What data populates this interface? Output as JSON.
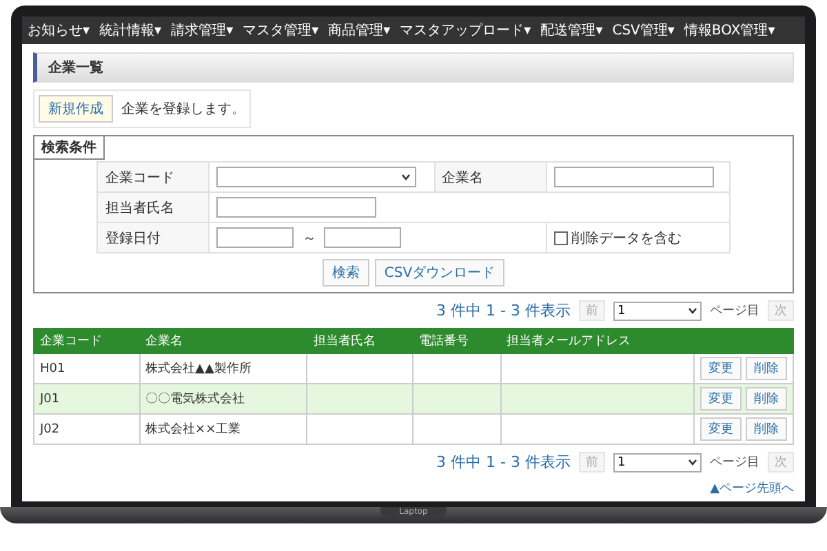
{
  "menu": [
    {
      "label": "お知らせ"
    },
    {
      "label": "統計情報"
    },
    {
      "label": "請求管理"
    },
    {
      "label": "マスタ管理"
    },
    {
      "label": "商品管理"
    },
    {
      "label": "マスタアップロード"
    },
    {
      "label": "配送管理"
    },
    {
      "label": "CSV管理"
    },
    {
      "label": "情報BOX管理"
    }
  ],
  "caret": "▾",
  "page_title": "企業一覧",
  "new_button": "新規作成",
  "new_note": "企業を登録します。",
  "search": {
    "title": "検索条件",
    "company_code_label": "企業コード",
    "company_name_label": "企業名",
    "person_label": "担当者氏名",
    "date_label": "登録日付",
    "date_separator": "～",
    "include_deleted": {
      "label": "削除データを含む",
      "checked": false
    },
    "buttons": [
      "検索",
      "CSVダウンロード"
    ]
  },
  "pager_top": {
    "summary": "3 件中 1 - 3 件表示",
    "prev": "前",
    "page": "1",
    "page_suffix": "ページ目",
    "next": "次"
  },
  "table": {
    "columns": [
      "企業コード",
      "企業名",
      "担当者氏名",
      "電話番号",
      "担当者メールアドレス"
    ],
    "rows": [
      {
        "cells": [
          "H01",
          "株式会社▲▲製作所",
          "",
          "",
          ""
        ],
        "highlighted": false,
        "actions": [
          "変更",
          "削除"
        ]
      },
      {
        "cells": [
          "J01",
          "〇〇電気株式会社",
          "",
          "",
          ""
        ],
        "highlighted": true,
        "actions": [
          "変更",
          "削除"
        ]
      },
      {
        "cells": [
          "J02",
          "株式会社××工業",
          "",
          "",
          ""
        ],
        "highlighted": false,
        "actions": [
          "変更",
          "削除"
        ]
      }
    ]
  },
  "pager_bottom": {
    "summary": "3 件中 1 - 3 件表示",
    "prev": "前",
    "page": "1",
    "page_suffix": "ページ目",
    "next": "次"
  },
  "top_link": "▲ページ先頭へ",
  "laptop_label": "Laptop"
}
